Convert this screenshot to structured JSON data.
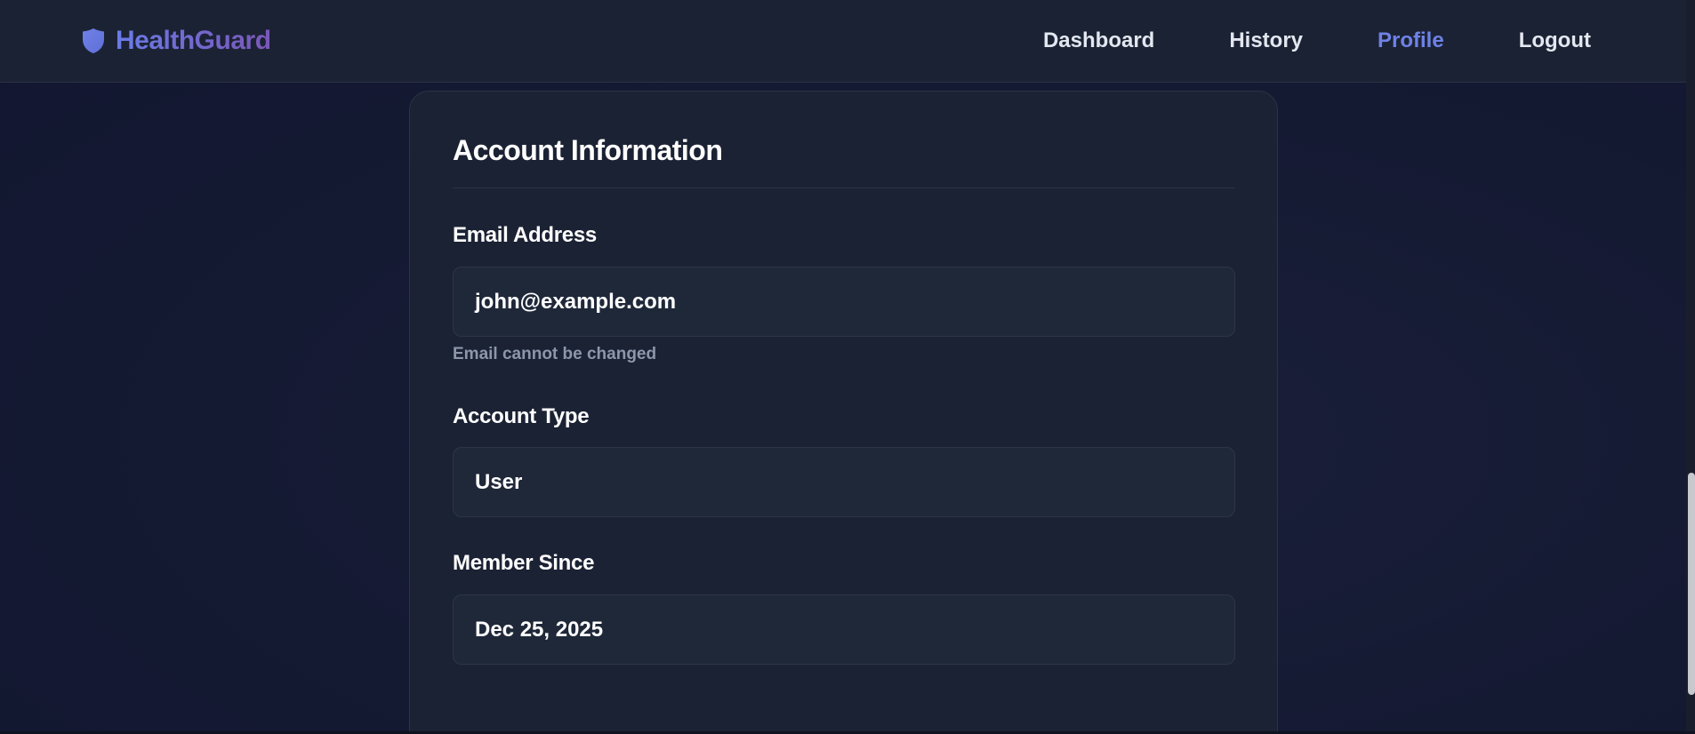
{
  "brand": {
    "name": "HealthGuard",
    "icon": "shield-icon",
    "gradient": [
      "#6a7be6",
      "#7b57b8"
    ]
  },
  "nav": {
    "items": [
      {
        "label": "Dashboard",
        "active": false
      },
      {
        "label": "History",
        "active": false
      },
      {
        "label": "Profile",
        "active": true
      },
      {
        "label": "Logout",
        "active": false
      }
    ],
    "active_color": "#6f82e6"
  },
  "account": {
    "title": "Account Information",
    "email": {
      "label": "Email Address",
      "value": "john@example.com",
      "hint": "Email cannot be changed"
    },
    "type": {
      "label": "Account Type",
      "value": "User"
    },
    "member_since": {
      "label": "Member Since",
      "value": "Dec 25, 2025"
    }
  },
  "colors": {
    "background": "#151a33",
    "card": "#1b2234",
    "field": "#1f2839",
    "hint": "#8d97ab"
  }
}
